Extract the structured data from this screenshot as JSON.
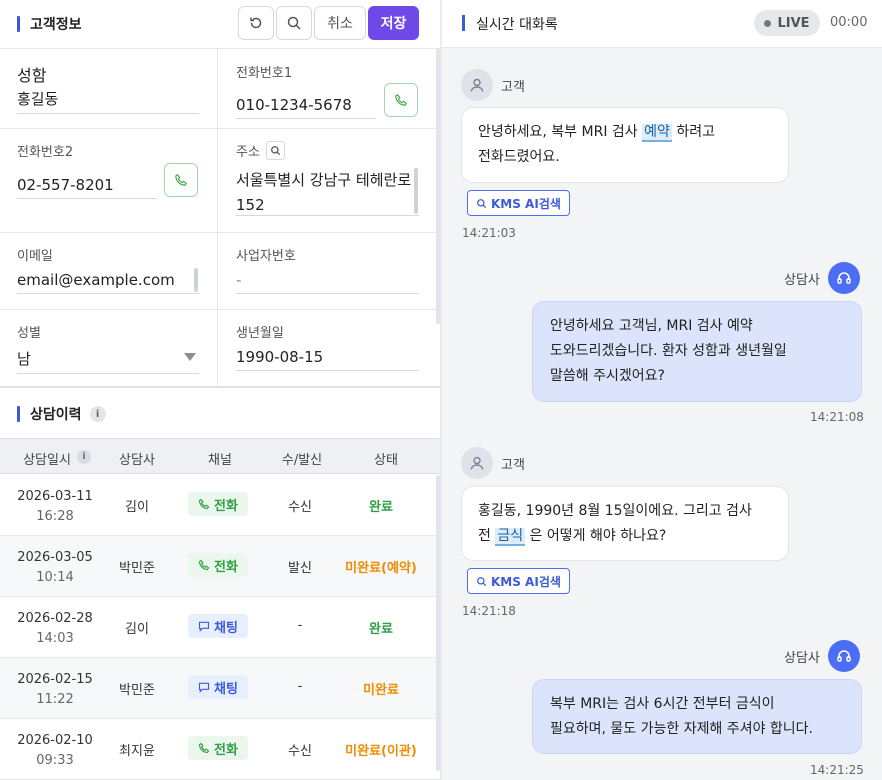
{
  "customer": {
    "title": "고객정보",
    "buttons": {
      "cancel": "취소",
      "save": "저장"
    },
    "fields": {
      "name": {
        "label": "성함",
        "value": "홍길동"
      },
      "phone1": {
        "label": "전화번호1",
        "value": "010-1234-5678"
      },
      "phone2": {
        "label": "전화번호2",
        "value": "02-557-8201"
      },
      "address": {
        "label": "주소",
        "value_line1": "서울특별시 강남구 테헤란로",
        "value_line2": "152"
      },
      "email": {
        "label": "이메일",
        "value": "email@example.com"
      },
      "bizno": {
        "label": "사업자번호",
        "value": "-"
      },
      "gender": {
        "label": "성별",
        "value": "남"
      },
      "birth": {
        "label": "생년월일",
        "value": "1990-08-15"
      }
    }
  },
  "history": {
    "title": "상담이력",
    "columns": [
      "상담일시",
      "상담사",
      "채널",
      "수/발신",
      "상태"
    ],
    "rows": [
      {
        "date": "2026-03-11",
        "time": "16:28",
        "agent": "김이",
        "channel": "전화",
        "dir": "수신",
        "status": "완료"
      },
      {
        "date": "2026-03-05",
        "time": "10:14",
        "agent": "박민준",
        "channel": "전화",
        "dir": "발신",
        "status": "미완료(예약)"
      },
      {
        "date": "2026-02-28",
        "time": "14:03",
        "agent": "김이",
        "channel": "채팅",
        "dir": "-",
        "status": "완료"
      },
      {
        "date": "2026-02-15",
        "time": "11:22",
        "agent": "박민준",
        "channel": "채팅",
        "dir": "-",
        "status": "미완료"
      },
      {
        "date": "2026-02-10",
        "time": "09:33",
        "agent": "최지윤",
        "channel": "전화",
        "dir": "수신",
        "status": "미완료(이관)"
      }
    ]
  },
  "transcript": {
    "title": "실시간 대화록",
    "live": "LIVE",
    "timer": "00:00",
    "kms_label": "KMS AI검색",
    "messages": [
      {
        "who": "고객",
        "pre": "안녕하세요, 복부 MRI 검사 ",
        "kw": "예약",
        "post": " 하려고",
        "line2": "전화드렸어요.",
        "time": "14:21:03"
      },
      {
        "who": "상담사",
        "line1": "안녕하세요 고객님, MRI 검사 예약",
        "line2": "도와드리겠습니다. 환자 성함과 생년월일",
        "line3": "말씀해 주시겠어요?",
        "time": "14:21:08"
      },
      {
        "who": "고객",
        "line1": "홍길동, 1990년 8월 15일이에요. 그리고 검사",
        "pre": "전 ",
        "kw": "금식",
        "post": " 은 어떻게 해야 하나요?",
        "time": "14:21:18"
      },
      {
        "who": "상담사",
        "line1": "복부 MRI는 검사 6시간 전부터 금식이",
        "line2": "필요하며, 물도 가능한 자제해 주셔야 합니다.",
        "time": "14:21:25"
      }
    ]
  }
}
